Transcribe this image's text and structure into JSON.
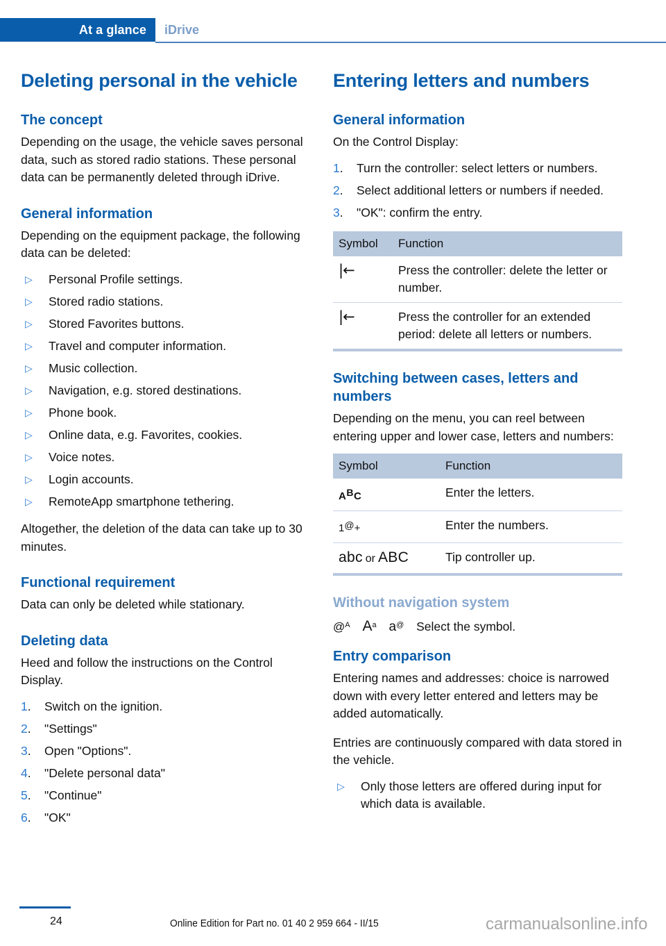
{
  "header": {
    "active_tab": "At a glance",
    "inactive_tab": "iDrive"
  },
  "left_column": {
    "chapter_title": "Deleting personal in the vehicle",
    "sections": [
      {
        "heading": "The concept",
        "paragraph": "Depending on the usage, the vehicle saves personal data, such as stored radio stations. These personal data can be permanently deleted through iDrive."
      },
      {
        "heading": "General information",
        "paragraph": "Depending on the equipment package, the following data can be deleted:",
        "bullets": [
          "Personal Profile settings.",
          "Stored radio stations.",
          "Stored Favorites buttons.",
          "Travel and computer information.",
          "Music collection.",
          "Navigation, e.g. stored destinations.",
          "Phone book.",
          "Online data, e.g. Favorites, cookies.",
          "Voice notes.",
          "Login accounts.",
          "RemoteApp smartphone tethering."
        ],
        "closing_paragraph": "Altogether, the deletion of the data can take up to 30 minutes."
      },
      {
        "heading": "Functional requirement",
        "paragraph": "Data can only be deleted while stationary."
      },
      {
        "heading": "Deleting data",
        "paragraph": "Heed and follow the instructions on the Control Display.",
        "steps": [
          "Switch on the ignition.",
          "\"Settings\"",
          "Open \"Options\".",
          "\"Delete personal data\"",
          "\"Continue\"",
          "\"OK\""
        ]
      }
    ]
  },
  "right_column": {
    "chapter_title": "Entering letters and numbers",
    "general_information": {
      "heading": "General information",
      "paragraph": "On the Control Display:",
      "steps": [
        "Turn the controller: select letters or numbers.",
        "Select additional letters or numbers if needed.",
        "\"OK\": confirm the entry."
      ]
    },
    "delete_table": {
      "columns": [
        "Symbol",
        "Function"
      ],
      "rows": [
        {
          "symbol": "backspace-arrow",
          "function": "Press the controller: delete the letter or number."
        },
        {
          "symbol": "backspace-arrow",
          "function": "Press the controller for an extended period: delete all letters or numbers."
        }
      ]
    },
    "switching": {
      "heading": "Switching between cases, letters and numbers",
      "paragraph": "Depending on the menu, you can reel between entering upper and lower case, letters and numbers:"
    },
    "cases_table": {
      "columns": [
        "Symbol",
        "Function"
      ],
      "rows": [
        {
          "symbol": "ABC",
          "symbol_parts": {
            "a": "A",
            "b": "B",
            "c": "C"
          },
          "function": "Enter the letters."
        },
        {
          "symbol": "1@+",
          "symbol_parts": {
            "one": "1",
            "at": "@",
            "plus": "+"
          },
          "function": "Enter the numbers."
        },
        {
          "symbol": "abc or ABC",
          "symbol_parts": {
            "lower": "abc",
            "conj": "or",
            "upper": "ABC"
          },
          "function": "Tip controller up."
        }
      ]
    },
    "without_nav": {
      "heading": "Without navigation system",
      "symbols": [
        {
          "base": "@",
          "sup": "A"
        },
        {
          "base": "A",
          "sup": "a"
        },
        {
          "base": "a",
          "sup": "@"
        }
      ],
      "text": "Select the symbol."
    },
    "entry_comparison": {
      "heading": "Entry comparison",
      "paragraph_1": "Entering names and addresses: choice is narrowed down with every letter entered and letters may be added automatically.",
      "paragraph_2": "Entries are continuously compared with data stored in the vehicle.",
      "bullets": [
        "Only those letters are offered during input for which data is available."
      ]
    }
  },
  "footer": {
    "page_number": "24",
    "edition": "Online Edition for Part no. 01 40 2 959 664 - II/15",
    "watermark": "carmanualsonline.info"
  },
  "markers": {
    "triangle_bullet": "▷",
    "backspace_arrow": "backspace-icon"
  },
  "colors": {
    "brand_blue": "#0a5daa",
    "muted_blue": "#8aa9cf",
    "table_header_bg": "#b8c8dd",
    "table_rule": "#c6d4e4"
  }
}
